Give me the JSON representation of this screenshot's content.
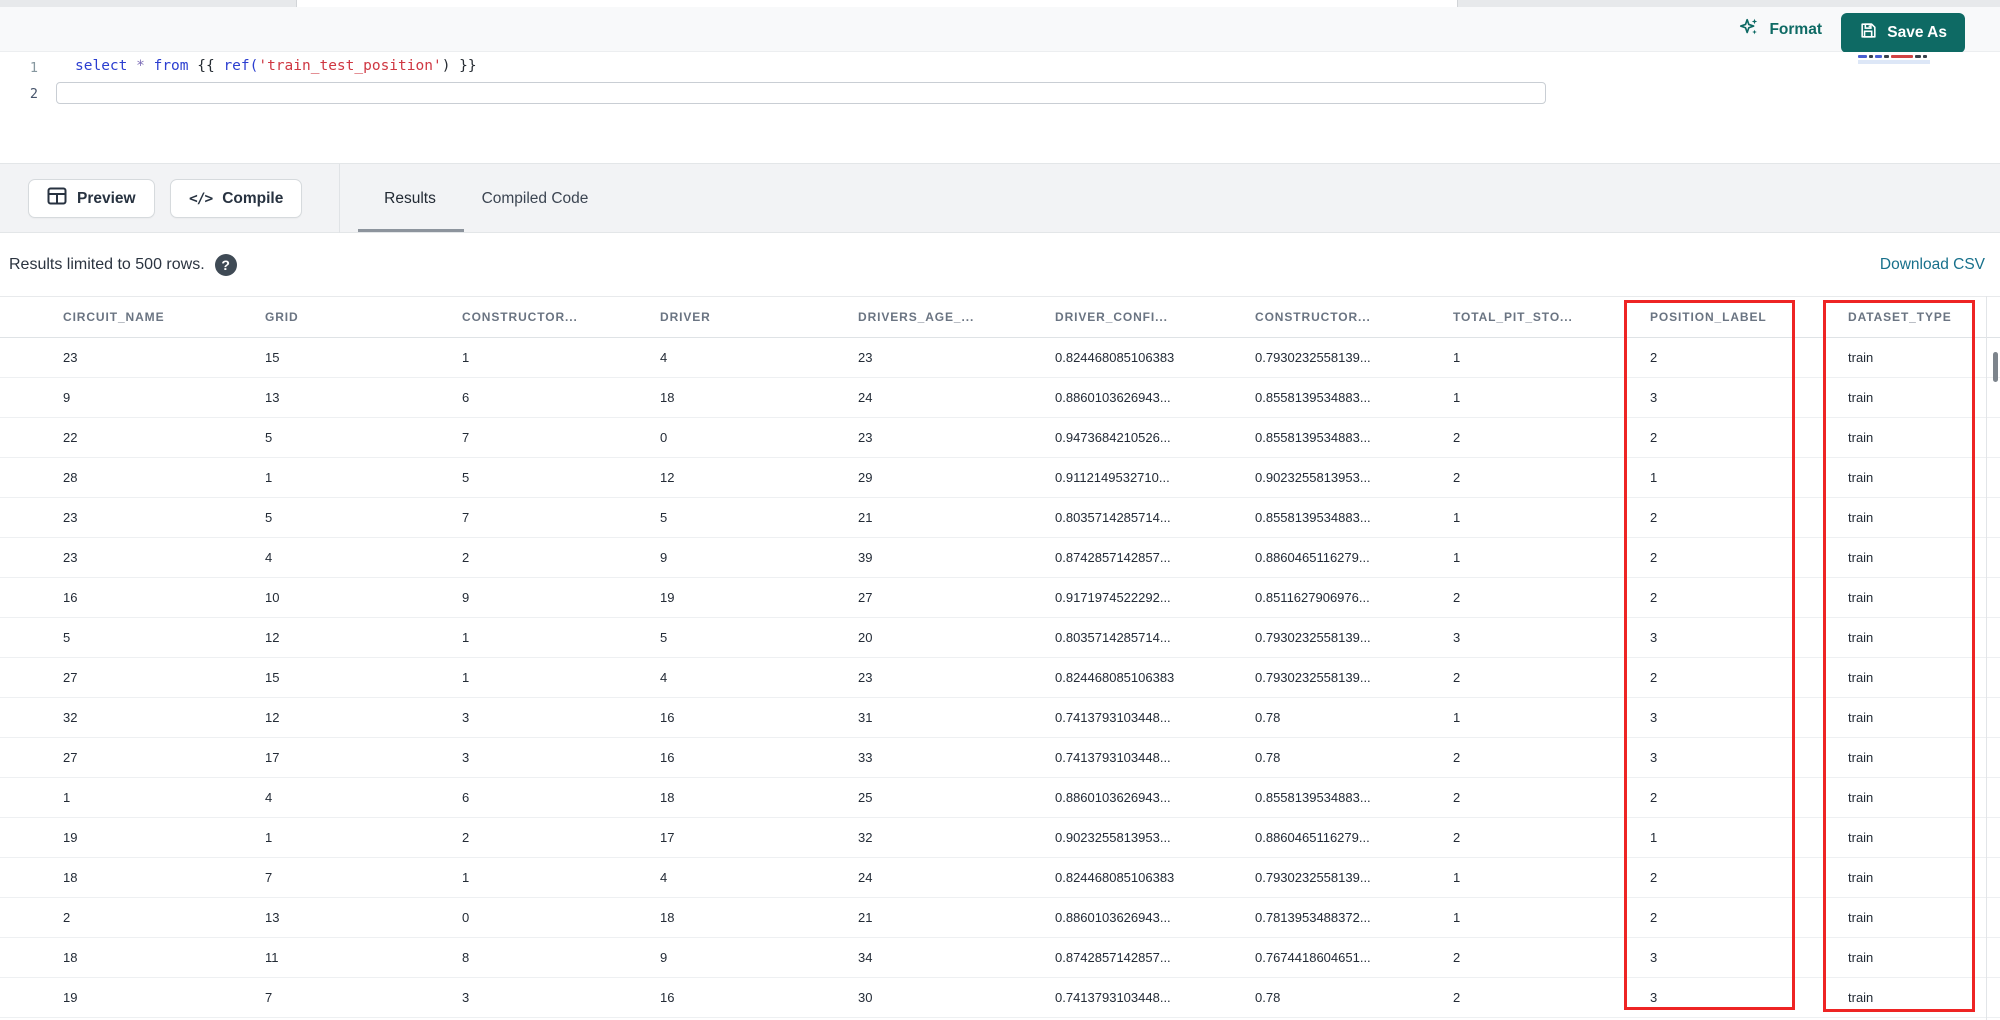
{
  "app": {
    "toolbar": {
      "format_label": "Format",
      "save_as_label": "Save As"
    },
    "editor": {
      "line_numbers": [
        "1",
        "2"
      ],
      "code_plain": "select * from {{ ref('train_test_position') }}",
      "code_tokens": [
        {
          "text": "select",
          "type": "keyword"
        },
        {
          "text": " ",
          "type": "bracket"
        },
        {
          "text": "*",
          "type": "operator"
        },
        {
          "text": " ",
          "type": "bracket"
        },
        {
          "text": "from",
          "type": "keyword"
        },
        {
          "text": " {{ ",
          "type": "bracket"
        },
        {
          "text": "ref(",
          "type": "function"
        },
        {
          "text": "'train_test_position'",
          "type": "string"
        },
        {
          "text": ")",
          "type": "bracket"
        },
        {
          "text": " }}",
          "type": "bracket"
        }
      ]
    },
    "actions": {
      "preview_label": "Preview",
      "compile_label": "Compile",
      "compile_glyph": "</>"
    },
    "result_tabs": [
      {
        "label": "Results",
        "active": true
      },
      {
        "label": "Compiled Code",
        "active": false
      }
    ],
    "results": {
      "limit_note": "Results limited to 500 rows.",
      "help_icon": "question-mark",
      "download_csv_label": "Download CSV",
      "annotation_red": "#ee2424",
      "accent_teal": "#0e6a64",
      "link_teal": "#17708b",
      "highlighted_columns": [
        "POSITION_LABEL",
        "DATASET_TYPE"
      ],
      "columns": [
        "CIRCUIT_NAME",
        "GRID",
        "CONSTRUCTOR...",
        "DRIVER",
        "DRIVERS_AGE_...",
        "DRIVER_CONFI...",
        "CONSTRUCTOR...",
        "TOTAL_PIT_STO...",
        "POSITION_LABEL",
        "DATASET_TYPE"
      ],
      "rows": [
        [
          "23",
          "15",
          "1",
          "4",
          "23",
          "0.824468085106383",
          "0.7930232558139...",
          "1",
          "2",
          "train"
        ],
        [
          "9",
          "13",
          "6",
          "18",
          "24",
          "0.8860103626943...",
          "0.8558139534883...",
          "1",
          "3",
          "train"
        ],
        [
          "22",
          "5",
          "7",
          "0",
          "23",
          "0.9473684210526...",
          "0.8558139534883...",
          "2",
          "2",
          "train"
        ],
        [
          "28",
          "1",
          "5",
          "12",
          "29",
          "0.9112149532710...",
          "0.9023255813953...",
          "2",
          "1",
          "train"
        ],
        [
          "23",
          "5",
          "7",
          "5",
          "21",
          "0.8035714285714...",
          "0.8558139534883...",
          "1",
          "2",
          "train"
        ],
        [
          "23",
          "4",
          "2",
          "9",
          "39",
          "0.8742857142857...",
          "0.8860465116279...",
          "1",
          "2",
          "train"
        ],
        [
          "16",
          "10",
          "9",
          "19",
          "27",
          "0.9171974522292...",
          "0.8511627906976...",
          "2",
          "2",
          "train"
        ],
        [
          "5",
          "12",
          "1",
          "5",
          "20",
          "0.8035714285714...",
          "0.7930232558139...",
          "3",
          "3",
          "train"
        ],
        [
          "27",
          "15",
          "1",
          "4",
          "23",
          "0.824468085106383",
          "0.7930232558139...",
          "2",
          "2",
          "train"
        ],
        [
          "32",
          "12",
          "3",
          "16",
          "31",
          "0.7413793103448...",
          "0.78",
          "1",
          "3",
          "train"
        ],
        [
          "27",
          "17",
          "3",
          "16",
          "33",
          "0.7413793103448...",
          "0.78",
          "2",
          "3",
          "train"
        ],
        [
          "1",
          "4",
          "6",
          "18",
          "25",
          "0.8860103626943...",
          "0.8558139534883...",
          "2",
          "2",
          "train"
        ],
        [
          "19",
          "1",
          "2",
          "17",
          "32",
          "0.9023255813953...",
          "0.8860465116279...",
          "2",
          "1",
          "train"
        ],
        [
          "18",
          "7",
          "1",
          "4",
          "24",
          "0.824468085106383",
          "0.7930232558139...",
          "1",
          "2",
          "train"
        ],
        [
          "2",
          "13",
          "0",
          "18",
          "21",
          "0.8860103626943...",
          "0.7813953488372...",
          "1",
          "2",
          "train"
        ],
        [
          "18",
          "11",
          "8",
          "9",
          "34",
          "0.8742857142857...",
          "0.7674418604651...",
          "2",
          "3",
          "train"
        ],
        [
          "19",
          "7",
          "3",
          "16",
          "30",
          "0.7413793103448...",
          "0.78",
          "2",
          "3",
          "train"
        ]
      ]
    }
  }
}
